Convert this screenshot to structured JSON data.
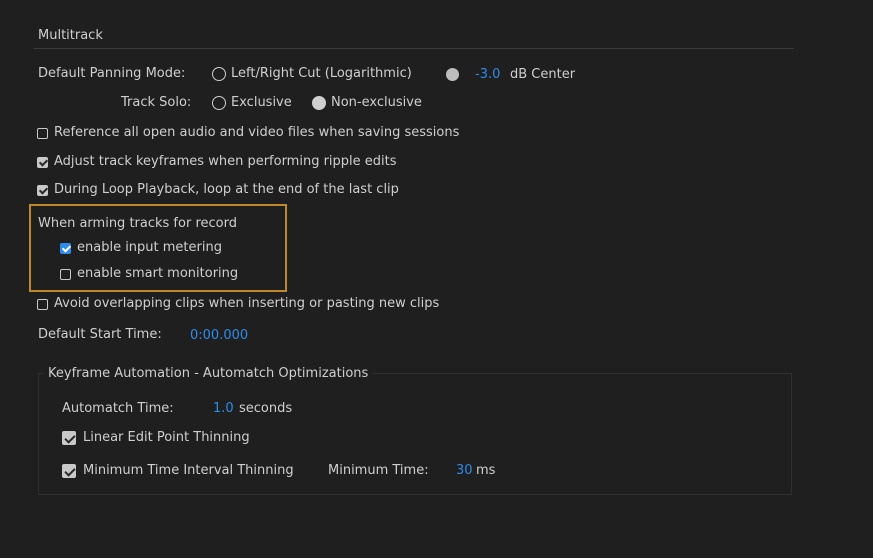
{
  "section_title": "Multitrack",
  "panning": {
    "label": "Default Panning Mode:",
    "option": "Left/Right Cut (Logarithmic)",
    "value": "-3.0",
    "unit": "dB Center"
  },
  "track_solo": {
    "label": "Track Solo:",
    "options": [
      "Exclusive",
      "Non-exclusive"
    ],
    "selected": "Non-exclusive"
  },
  "checkboxes": [
    {
      "label": "Reference all open audio and video files when saving sessions",
      "checked": false
    },
    {
      "label": "Adjust track keyframes when performing ripple edits",
      "checked": true
    },
    {
      "label": "During Loop Playback, loop at the end of the last clip",
      "checked": true
    }
  ],
  "arming": {
    "title": "When arming tracks for record",
    "options": [
      {
        "label": "enable input metering",
        "checked": true
      },
      {
        "label": "enable smart monitoring",
        "checked": false
      }
    ]
  },
  "avoid_overlap": {
    "label": "Avoid overlapping clips when inserting or pasting new clips",
    "checked": false
  },
  "start_time": {
    "label": "Default Start Time:",
    "value": "0:00.000"
  },
  "keyframe": {
    "title": "Keyframe Automation - Automatch Optimizations",
    "automatch_label": "Automatch Time:",
    "automatch_value": "1.0",
    "automatch_unit": "seconds",
    "linear": {
      "label": "Linear Edit Point Thinning",
      "checked": true
    },
    "min_interval": {
      "label": "Minimum Time Interval Thinning",
      "checked": true
    },
    "min_time_label": "Minimum Time:",
    "min_time_value": "30",
    "min_time_unit": "ms"
  },
  "colors": {
    "accent": "#2d8ceb",
    "highlight": "#c08a2c",
    "background": "#1f1f1f"
  }
}
